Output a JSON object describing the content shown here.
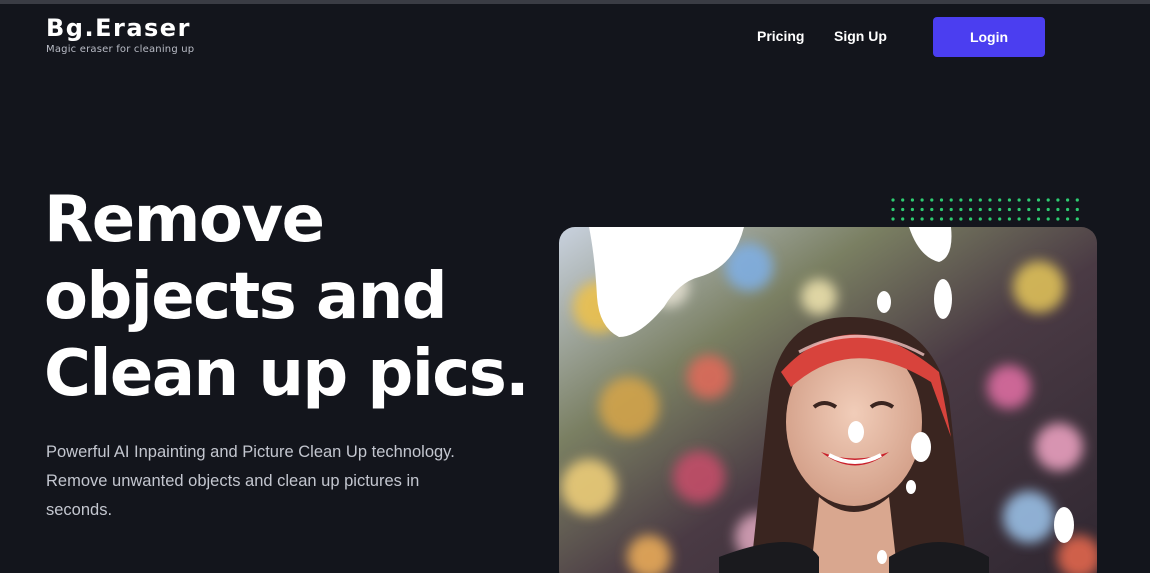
{
  "brand": {
    "name": "Bg.Eraser",
    "tagline": "Magic eraser for cleaning up"
  },
  "nav": {
    "pricing": "Pricing",
    "signup": "Sign Up",
    "login": "Login"
  },
  "hero": {
    "title_line1": "Remove",
    "title_line2": "objects and",
    "title_line3": "Clean up pics.",
    "subtitle_line1": "Powerful AI Inpainting and Picture Clean Up technology.",
    "subtitle_line2": "Remove unwanted objects and clean up pictures in",
    "subtitle_line3": "seconds.",
    "image_icon": "smiling-woman-bandana-photo"
  },
  "colors": {
    "background": "#13151c",
    "accent": "#4b3ef0",
    "dots": "#2ecc71",
    "text_muted": "#c3c6cf"
  }
}
